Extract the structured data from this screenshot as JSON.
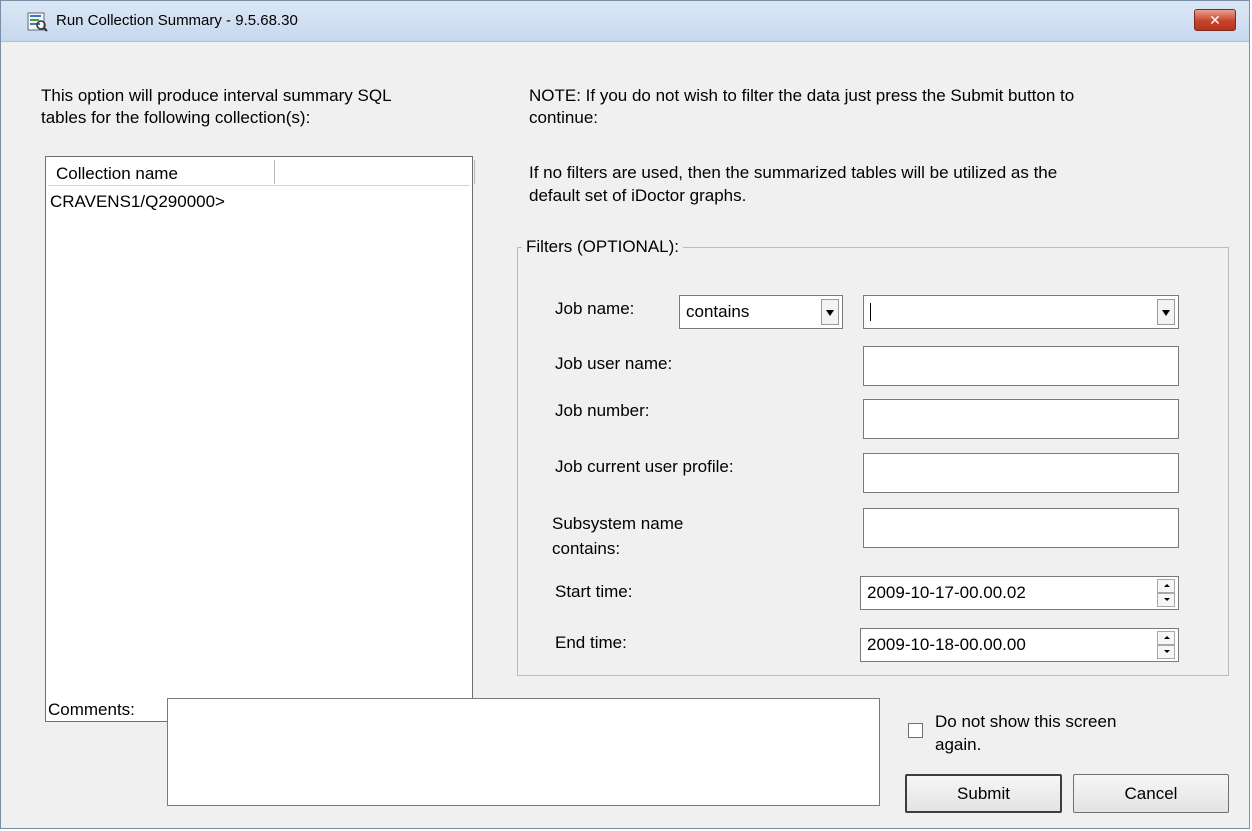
{
  "window": {
    "title": "Run Collection Summary - 9.5.68.30",
    "close_label": "✕"
  },
  "intro_text_line1": "This option will produce interval summary SQL",
  "intro_text_line2": "tables for the following collection(s):",
  "note_text_line1": "NOTE: If you do not wish to filter the data just press the Submit button to",
  "note_text_line2": "continue:",
  "info_text_line1": "If no filters are used, then the summarized tables will be utilized as the",
  "info_text_line2": "default set of iDoctor graphs.",
  "collection_list": {
    "column_header": "Collection name",
    "rows": [
      "CRAVENS1/Q290000>"
    ]
  },
  "filters": {
    "legend": "Filters (OPTIONAL):",
    "job_name_label": "Job name:",
    "job_name_operator": "contains",
    "job_name_value": "",
    "job_user_name_label": "Job user name:",
    "job_user_name_value": "",
    "job_number_label": "Job number:",
    "job_number_value": "",
    "job_current_user_label": "Job current user profile:",
    "job_current_user_value": "",
    "subsystem_label_line1": "Subsystem name",
    "subsystem_label_line2": "contains:",
    "subsystem_value": "",
    "start_time_label": "Start time:",
    "start_time_value": "2009-10-17-00.00.02",
    "end_time_label": "End time:",
    "end_time_value": "2009-10-18-00.00.00"
  },
  "comments_label": "Comments:",
  "comments_value": "",
  "dont_show_line1": "Do not show this screen",
  "dont_show_line2": "again.",
  "dont_show_checked": false,
  "buttons": {
    "submit": "Submit",
    "cancel": "Cancel"
  }
}
